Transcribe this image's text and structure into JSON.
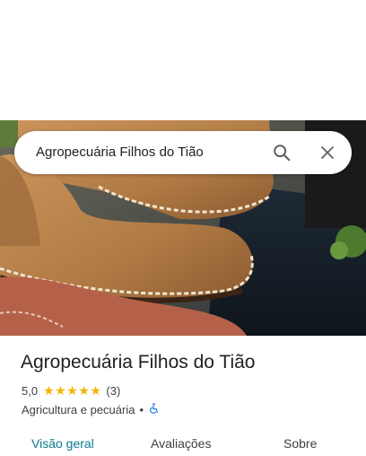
{
  "search": {
    "query": "Agropecuária Filhos do Tião",
    "search_icon": "search-icon",
    "close_icon": "close-icon"
  },
  "place": {
    "name": "Agropecuária Filhos do Tião",
    "rating": "5,0",
    "stars": 5,
    "reviews_count": "(3)",
    "category": "Agricultura e pecuária",
    "separator": "•",
    "accessibility_icon": "wheelchair-icon"
  },
  "tabs": [
    {
      "label": "Visão geral",
      "active": true
    },
    {
      "label": "Avaliações",
      "active": false
    },
    {
      "label": "Sobre",
      "active": false
    }
  ],
  "colors": {
    "star": "#f4b400",
    "active_tab": "#0b7a8c",
    "accessibility": "#1a73e8"
  }
}
